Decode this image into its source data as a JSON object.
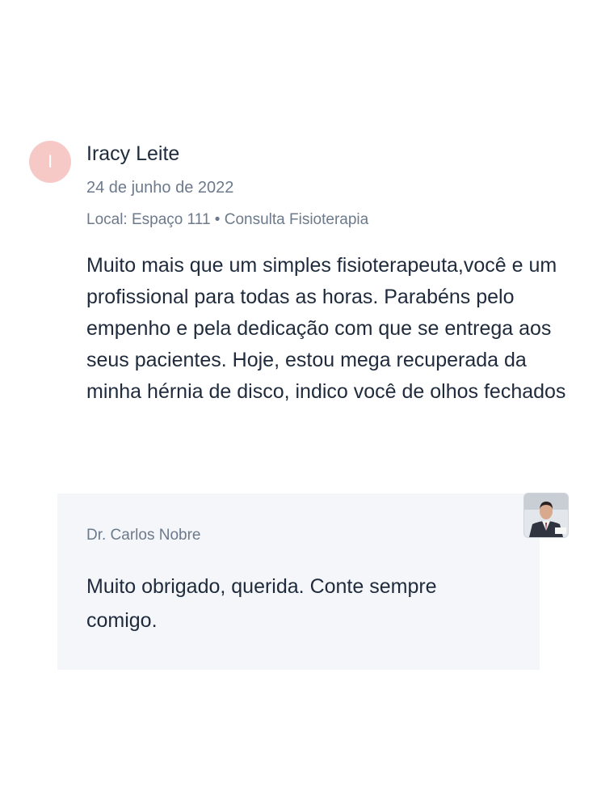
{
  "review": {
    "avatar_initial": "I",
    "reviewer_name": "Iracy Leite",
    "date": "24 de junho de 2022",
    "meta": "Local: Espaço 111 • Consulta Fisioterapia",
    "text": "Muito mais que um simples fisioterapeuta,você e um\nprofissional para todas as horas. Parabéns pelo empenho e pela dedicação com que se entrega aos seus pacientes. Hoje, estou mega recuperada da minha hérnia de disco, indico você de olhos fechados"
  },
  "reply": {
    "author": "Dr. Carlos Nobre",
    "text": "Muito obrigado, querida. Conte sempre comigo."
  },
  "colors": {
    "avatar_bg": "#f6c9c7",
    "reply_bg": "#f4f6f9",
    "muted_text": "#6d7a8b",
    "main_text": "#1f2b3c"
  }
}
